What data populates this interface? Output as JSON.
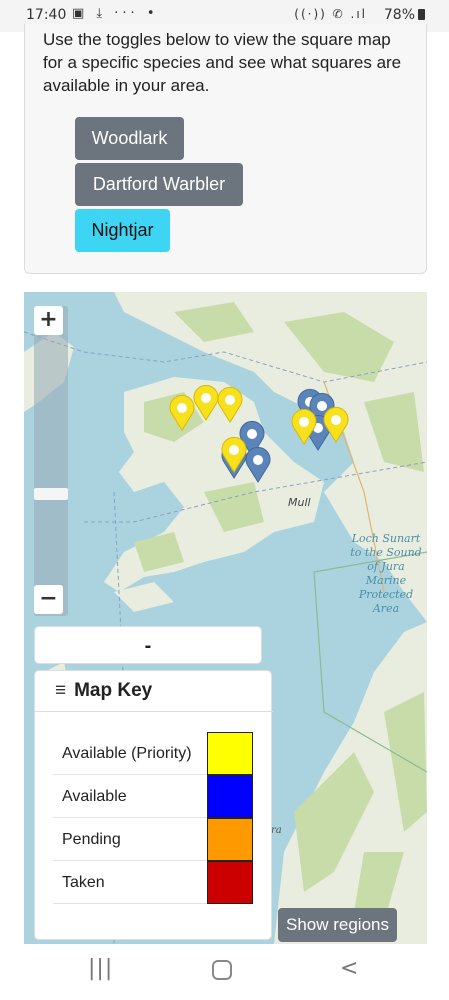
{
  "status_bar": {
    "time": "17:40",
    "left_icons": "▣ ⤓ ··· •",
    "right_icons": "((·)) ✆ .ıl",
    "battery_text": "78%"
  },
  "intro": {
    "text": "Use the toggles below to view the square map for a specific species and see what squares are available in your area.",
    "buttons": [
      {
        "label": "Woodlark",
        "active": false
      },
      {
        "label": "Dartford Warbler",
        "active": false
      },
      {
        "label": "Nightjar",
        "active": true
      }
    ]
  },
  "map": {
    "labels": {
      "mull": "Mull",
      "loch": "Loch Sunart to the Sound of Jura Marine Protected Area",
      "partial": "ra"
    },
    "zoom_in_label": "+",
    "zoom_out_label": "−",
    "region_value": "-",
    "show_regions_label": "Show regions",
    "key": {
      "menu_icon": "≡",
      "title": "Map Key",
      "rows": [
        {
          "label": "Available (Priority)",
          "color": "#ffff00"
        },
        {
          "label": "Available",
          "color": "#0000ff"
        },
        {
          "label": "Pending",
          "color": "#ff9900"
        },
        {
          "label": "Taken",
          "color": "#cc0000"
        }
      ]
    },
    "colors": {
      "sea": "#aad3df",
      "land": "#e9eddf",
      "green": "#c8dcaa",
      "priority_pin": "#f7e11d",
      "available_pin": "#5b84b8"
    }
  },
  "nav": {
    "recent_icon": "|||",
    "back_icon": "<"
  }
}
